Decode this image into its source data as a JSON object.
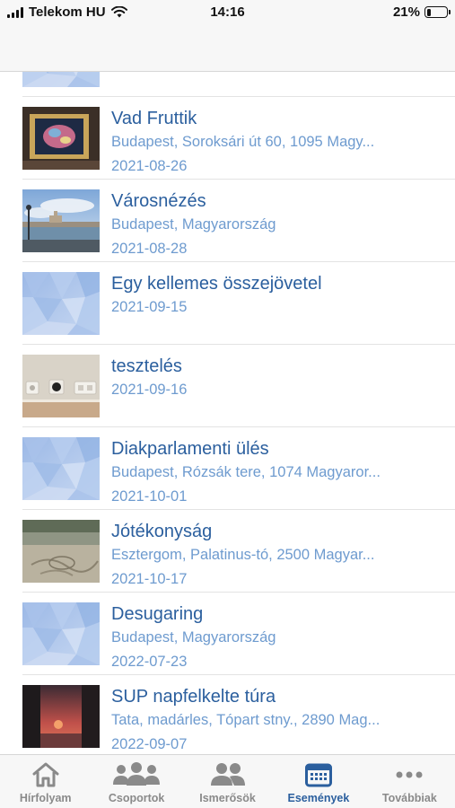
{
  "status_bar": {
    "carrier": "Telekom HU",
    "time": "14:16",
    "battery": "21%",
    "battery_level": 0.21
  },
  "events": [
    {
      "title": "",
      "location": "",
      "date": "",
      "thumb": "placeholder"
    },
    {
      "title": "Vad Fruttik",
      "location": "Budapest, Soroksári út 60, 1095 Magy...",
      "date": "2021-08-26",
      "thumb": "photo-framed-picture"
    },
    {
      "title": "Városnézés",
      "location": "Budapest, Magyarország",
      "date": "2021-08-28",
      "thumb": "photo-city-river"
    },
    {
      "title": "Egy kellemes összejövetel",
      "location": "",
      "date": "2021-09-15",
      "thumb": "placeholder"
    },
    {
      "title": "tesztelés",
      "location": "",
      "date": "2021-09-16",
      "thumb": "photo-wall-socket"
    },
    {
      "title": "Diakparlamenti ülés",
      "location": "Budapest, Rózsák tere, 1074 Magyaror...",
      "date": "2021-10-01",
      "thumb": "placeholder"
    },
    {
      "title": "Jótékonyság",
      "location": "Esztergom, Palatinus-tó, 2500 Magyar...",
      "date": "2021-10-17",
      "thumb": "photo-sand-beach"
    },
    {
      "title": "Desugaring",
      "location": "Budapest, Magyarország",
      "date": "2022-07-23",
      "thumb": "placeholder"
    },
    {
      "title": "SUP napfelkelte túra",
      "location": "Tata, madárles, Tópart stny., 2890 Mag...",
      "date": "2022-09-07",
      "thumb": "photo-sunrise"
    }
  ],
  "tabbar": {
    "items": [
      {
        "label": "Hírfolyam",
        "icon": "home-icon",
        "active": false
      },
      {
        "label": "Csoportok",
        "icon": "groups-icon",
        "active": false
      },
      {
        "label": "Ismerősök",
        "icon": "friends-icon",
        "active": false
      },
      {
        "label": "Események",
        "icon": "calendar-icon",
        "active": true
      },
      {
        "label": "Továbbiak",
        "icon": "more-icon",
        "active": false
      }
    ]
  },
  "colors": {
    "title": "#2b5f9e",
    "subtitle": "#6e9bcf",
    "tab_active": "#2b5f9e",
    "tab_inactive": "#8a8a8a"
  }
}
